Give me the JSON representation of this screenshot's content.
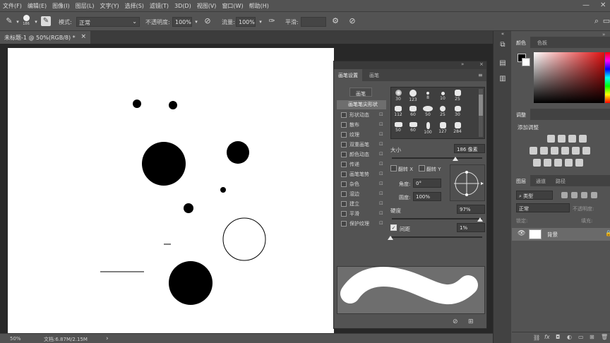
{
  "menu": {
    "items": [
      "文件(F)",
      "编辑(E)",
      "图像(I)",
      "图层(L)",
      "文字(Y)",
      "选择(S)",
      "滤镜(T)",
      "3D(D)",
      "视图(V)",
      "窗口(W)",
      "帮助(H)"
    ],
    "minimize": "—",
    "close": "✕"
  },
  "options": {
    "brush_size": "186",
    "mode_label": "模式:",
    "mode_value": "正常",
    "opacity_label": "不透明度:",
    "opacity_value": "100%",
    "flow_label": "流量:",
    "flow_value": "100%",
    "smooth_label": "平滑:",
    "smooth_value": ""
  },
  "document": {
    "tab_title": "未标题-1 @ 50%(RGB/8) *",
    "tab_close": "×"
  },
  "status": {
    "zoom": "50%",
    "doc_info": "文档:6.87M/2.15M",
    "arrow": "›"
  },
  "color_panel": {
    "tabs": [
      "颜色",
      "色板"
    ]
  },
  "adjust_panel": {
    "tab": "调整",
    "title": "添加调整"
  },
  "layers_panel": {
    "tabs": [
      "图层",
      "通道",
      "路径"
    ],
    "filter_label": "类型",
    "blend_mode": "正常",
    "opacity_label": "不透明度:",
    "lock_label": "锁定:",
    "fill_label": "填充:",
    "layer_name": "背景"
  },
  "brush_panel": {
    "tabs": [
      "画笔设置",
      "画笔"
    ],
    "brushes_button": "画笔",
    "tip_shape": "画笔笔尖形状",
    "options": [
      "形状动态",
      "散布",
      "纹理",
      "双重画笔",
      "颜色动态",
      "传递",
      "画笔笔势",
      "杂色",
      "湿边",
      "建立",
      "平滑",
      "保护纹理"
    ],
    "tip_sizes": [
      "30",
      "123",
      "8",
      "10",
      "25",
      "112",
      "60",
      "50",
      "25",
      "30",
      "50",
      "60",
      "100",
      "127",
      "284"
    ],
    "size_label": "大小",
    "size_value": "186 像素",
    "flip_x": "翻转 X",
    "flip_y": "翻转 Y",
    "angle_label": "角度:",
    "angle_value": "0°",
    "roundness_label": "圆度:",
    "roundness_value": "100%",
    "hardness_label": "硬度",
    "hardness_value": "97%",
    "spacing_label": "间距",
    "spacing_value": "1%",
    "spacing_checked": true
  }
}
